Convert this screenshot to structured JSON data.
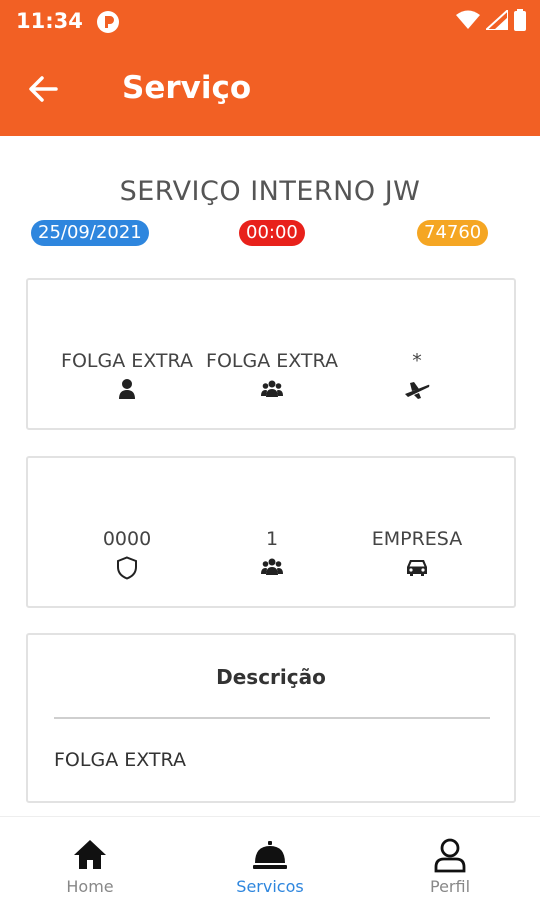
{
  "status_bar": {
    "time": "11:34"
  },
  "app_bar": {
    "title": "Serviço",
    "back_icon": "arrow-left-icon"
  },
  "service": {
    "title": "SERVIÇO INTERNO JW",
    "date": "25/09/2021",
    "time": "00:00",
    "code": "74760"
  },
  "card1": {
    "items": [
      {
        "text": "FOLGA EXTRA",
        "icon": "person-icon"
      },
      {
        "text": "FOLGA EXTRA",
        "icon": "group-icon"
      },
      {
        "text": "*",
        "icon": "airplane-icon"
      }
    ]
  },
  "card2": {
    "items": [
      {
        "text": "0000",
        "icon": "shield-icon"
      },
      {
        "text": "1",
        "icon": "group-icon"
      },
      {
        "text": "EMPRESA",
        "icon": "car-icon"
      }
    ]
  },
  "description": {
    "title": "Descrição",
    "text": "FOLGA EXTRA"
  },
  "bottom_nav": {
    "items": [
      {
        "label": "Home",
        "icon": "home-icon",
        "active": false
      },
      {
        "label": "Servicos",
        "icon": "service-bell-icon",
        "active": true
      },
      {
        "label": "Perfil",
        "icon": "person-outline-icon",
        "active": false
      }
    ]
  },
  "colors": {
    "brand": "#f26024",
    "date_badge": "#2e86de",
    "time_badge": "#e8211b",
    "code_badge": "#f5a623",
    "nav_active": "#2e86de"
  }
}
